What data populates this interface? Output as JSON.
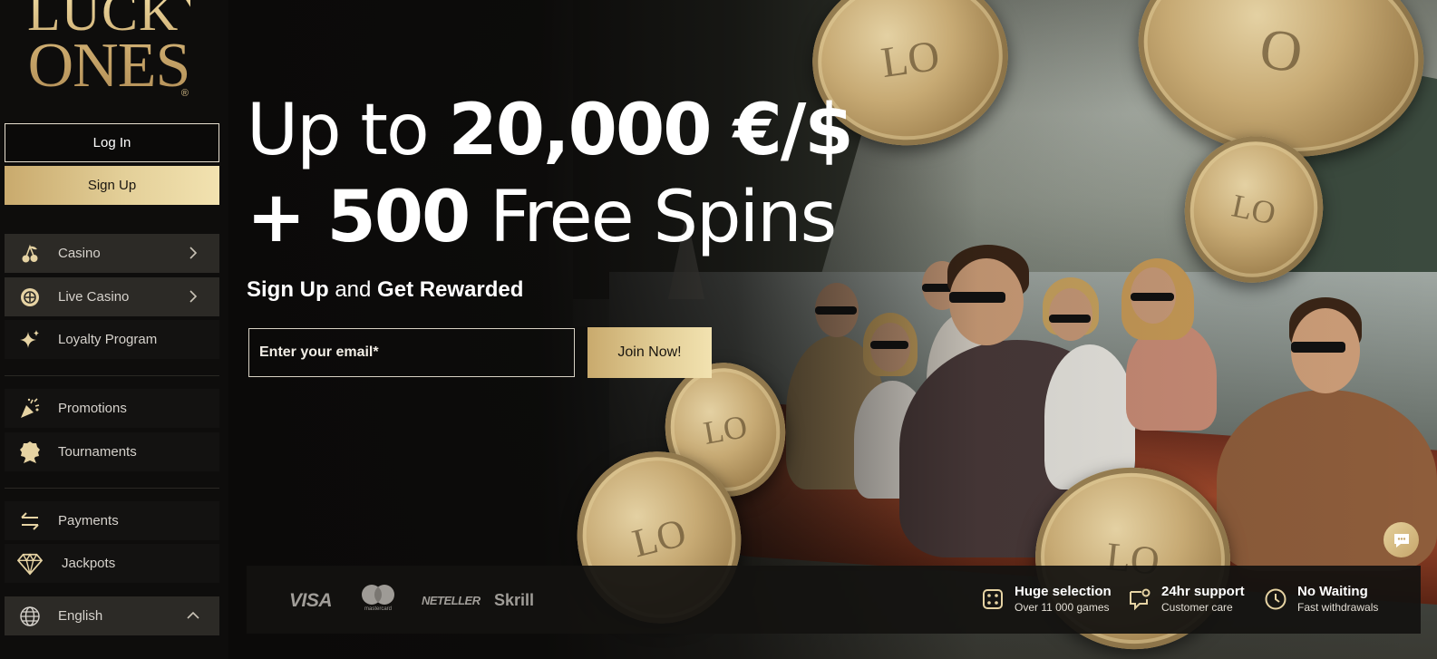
{
  "brand": {
    "line1": "LUCKY",
    "line2": "ONES",
    "reg": "®"
  },
  "auth": {
    "login_label": "Log In",
    "signup_label": "Sign Up"
  },
  "sidebar": {
    "items": [
      {
        "label": "Casino",
        "icon": "cherries-icon",
        "expandable": true
      },
      {
        "label": "Live Casino",
        "icon": "poker-chip-icon",
        "expandable": true
      },
      {
        "label": "Loyalty Program",
        "icon": "sparkles-icon",
        "expandable": false
      },
      {
        "label": "Promotions",
        "icon": "party-popper-icon",
        "expandable": false
      },
      {
        "label": "Tournaments",
        "icon": "award-badge-icon",
        "expandable": false
      },
      {
        "label": "Payments",
        "icon": "transfer-arrows-icon",
        "expandable": false
      },
      {
        "label": "Jackpots",
        "icon": "diamond-icon",
        "expandable": false
      }
    ],
    "language": {
      "label": "English",
      "icon": "globe-icon"
    }
  },
  "hero": {
    "line1_prefix": "Up to ",
    "line1_amount": "20,000 €/$",
    "line2_amount": "+ 500",
    "line2_suffix": " Free Spins",
    "sub_part1": "Sign Up",
    "sub_part2": " and ",
    "sub_part3": "Get Rewarded",
    "email_placeholder": "Enter your email*",
    "join_label": "Join Now!"
  },
  "payments": [
    "VISA",
    "mastercard",
    "NETELLER",
    "Skrill"
  ],
  "features": [
    {
      "title": "Huge selection",
      "sub": "Over 11 000 games",
      "icon": "dice-icon"
    },
    {
      "title": "24hr support",
      "sub": "Customer care",
      "icon": "chat-support-icon"
    },
    {
      "title": "No Waiting",
      "sub": "Fast withdrawals",
      "icon": "clock-icon"
    }
  ],
  "colors": {
    "gold": "#d8bf8a",
    "gold_light": "#f2e2b0",
    "bg": "#0b0a09",
    "nav_bg": "#131211",
    "nav_expand_bg": "#2c2a26"
  }
}
